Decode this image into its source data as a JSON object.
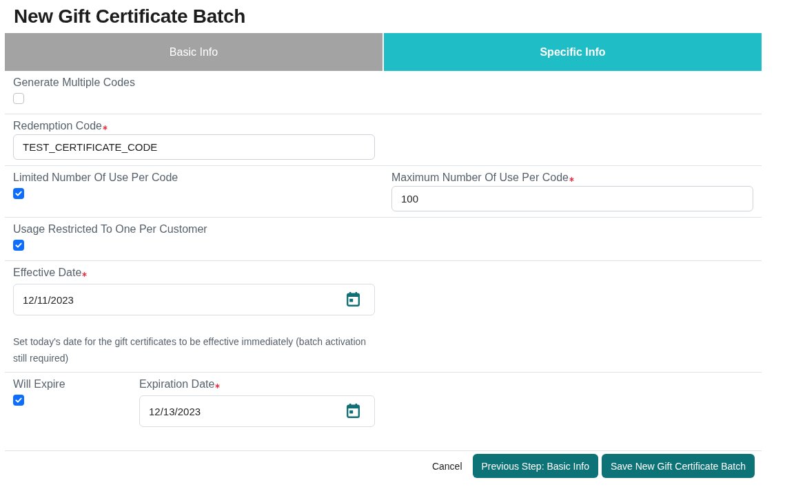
{
  "title": "New Gift Certificate Batch",
  "steps": [
    {
      "label": "Basic Info",
      "selected": false
    },
    {
      "label": "Specific Info",
      "selected": true
    }
  ],
  "form": {
    "rows": [
      {
        "kind": "columns",
        "fields": [
          {
            "kind": "checkbox",
            "label": "Generate Multiple Codes",
            "checked": false
          }
        ]
      },
      {
        "kind": "columns",
        "fields": [
          {
            "kind": "text",
            "label": "Redemption Code",
            "required": true,
            "value": "TEST_CERTIFICATE_CODE"
          }
        ]
      },
      {
        "kind": "columns",
        "fields": [
          {
            "kind": "checkbox",
            "label": "Limited Number Of Use Per Code",
            "checked": true
          },
          {
            "kind": "text",
            "label": "Maximum Number Of Use Per Code",
            "required": true,
            "value": "100"
          }
        ]
      },
      {
        "kind": "columns",
        "fields": [
          {
            "kind": "checkbox",
            "label": "Usage Restricted To One Per Customer",
            "checked": true
          }
        ]
      },
      {
        "kind": "columns",
        "fields": [
          {
            "kind": "date",
            "label": "Effective Date",
            "required": true,
            "value": "12/11/2023",
            "help": "Set today's date for the gift certificates to be effective immediately (batch activation still required)"
          }
        ]
      },
      {
        "kind": "inline",
        "fields": [
          {
            "kind": "checkbox",
            "label": "Will Expire",
            "checked": true
          },
          {
            "kind": "date",
            "label": "Expiration Date",
            "required": true,
            "value": "12/13/2023"
          }
        ]
      }
    ]
  },
  "actions": [
    {
      "kind": "link",
      "label": "Cancel"
    },
    {
      "kind": "primary",
      "label": "Previous Step: Basic Info"
    },
    {
      "kind": "primary",
      "label": "Save New Gift Certificate Batch"
    }
  ]
}
